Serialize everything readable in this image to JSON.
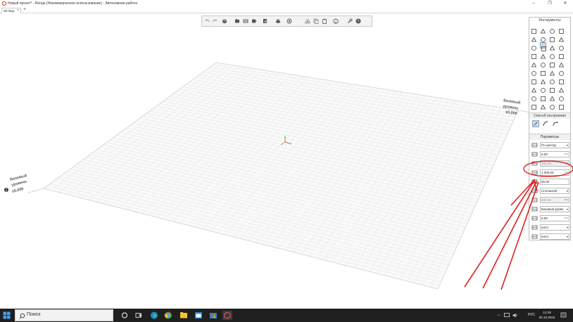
{
  "window": {
    "title": "Новый проект* - Renga (Некоммерческое использование) - Автономная работа",
    "minimize_label": "–",
    "maximize_label": "❐",
    "close_label": "✕",
    "title_color": "#333333"
  },
  "tabs": [
    {
      "label": "3D Вид",
      "close": "×"
    }
  ],
  "tab_add": "+",
  "toolbar": {
    "icons": [
      "undo-icon",
      "redo-icon",
      "view-cube-icon",
      "camera-icon",
      "level-icon",
      "section-icon",
      "display-style-icon",
      "visibility-icon",
      "cut-icon",
      "copy-icon",
      "paste-icon",
      "properties-icon",
      "settings-icon",
      "help-icon"
    ]
  },
  "viewport": {
    "level_label_right_1": "Базовый",
    "level_label_right_2": "уровень",
    "level_elev_right": "±0,000",
    "level_label_left_1": "Базовый",
    "level_label_left_2": "уровень",
    "level_elev_left": "±0,000",
    "grid_color": "#e6e6e6",
    "grid_outline": "#cfcfcf"
  },
  "panel": {
    "tools_title": "Инструменты",
    "method_title": "Способ построения",
    "params_title": "Параметры",
    "params": [
      {
        "value": "По центру",
        "type": "dropdown"
      },
      {
        "value": "0,00",
        "unit": "мм"
      },
      {
        "value": "100,00",
        "unit": "мм",
        "disabled": true
      },
      {
        "value": "1 000,00",
        "unit": "мм"
      },
      {
        "value": "90,00",
        "unit": "°"
      },
      {
        "value": "Сплошной",
        "type": "dropdown"
      },
      {
        "value": "200,00",
        "unit": "мм",
        "disabled": true
      },
      {
        "value": "Базовый урове",
        "type": "dropdown"
      },
      {
        "value": "0,00",
        "unit": "мм"
      },
      {
        "value": "(нет)",
        "type": "dropdown"
      },
      {
        "value": "(нет)",
        "type": "dropdown"
      }
    ],
    "dropdown_glyph": "▾",
    "accent_color": "#8aa3c0"
  },
  "annotation": {
    "color": "#e02020"
  },
  "taskbar": {
    "search_placeholder": "Поиск",
    "language": "РУС",
    "time": "12:29",
    "date": "05.10.2023",
    "apps": [
      "task-view-icon",
      "widgets-icon",
      "edge-icon",
      "chrome-icon",
      "file-explorer-icon",
      "calendar-icon",
      "store-icon",
      "renga-icon"
    ]
  }
}
